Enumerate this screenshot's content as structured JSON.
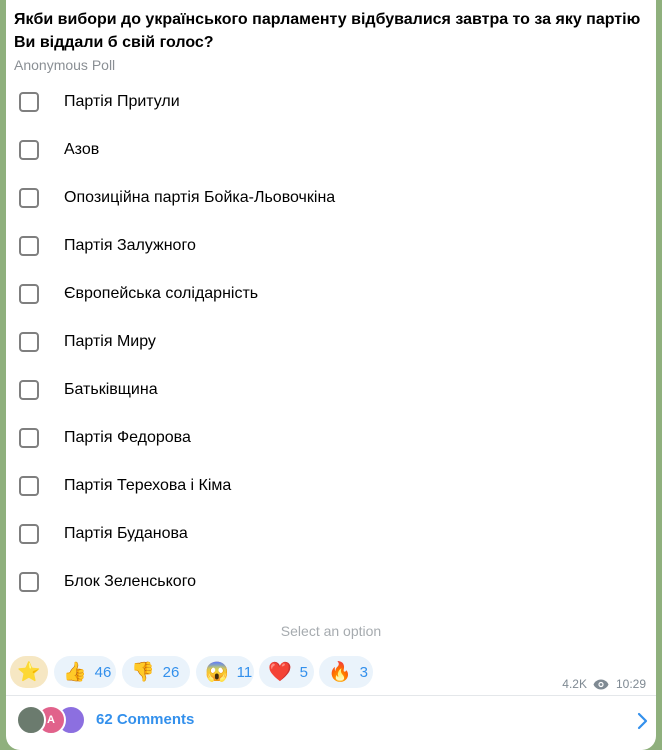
{
  "poll": {
    "question": "Якби вибори до українського парламенту відбувалися завтра то за яку партію Ви віддали б свій голос?",
    "type_label": "Anonymous Poll",
    "options": [
      "Партія Притули",
      "Азов",
      "Опозиційна партія Бойка-Льовочкіна",
      "Партія Залужного",
      "Європейська солідарність",
      "Партія Миру",
      "Батьківщина",
      "Партія Федорова",
      "Партія Терехова і Кіма",
      "Партія Буданова",
      "Блок Зеленського"
    ],
    "hint": "Select an option"
  },
  "reactions": [
    {
      "icon": "thumbs-up-icon",
      "emoji": "👍",
      "count": "46"
    },
    {
      "icon": "thumbs-down-icon",
      "emoji": "👎",
      "count": "26"
    },
    {
      "icon": "screaming-face-icon",
      "emoji": "😱",
      "count": "11"
    },
    {
      "icon": "heart-icon",
      "emoji": "❤️",
      "count": "5"
    },
    {
      "icon": "fire-icon",
      "emoji": "🔥",
      "count": "3"
    }
  ],
  "star_reaction": {
    "icon": "star-icon",
    "emoji": "⭐"
  },
  "meta": {
    "views": "4.2K",
    "time": "10:29"
  },
  "comments": {
    "label": "62 Comments",
    "avatars": [
      {
        "initials": "",
        "color": "#6b7b6e"
      },
      {
        "initials": "A",
        "color": "#e1628b"
      },
      {
        "initials": "",
        "color": "#8c6fe0"
      }
    ]
  }
}
